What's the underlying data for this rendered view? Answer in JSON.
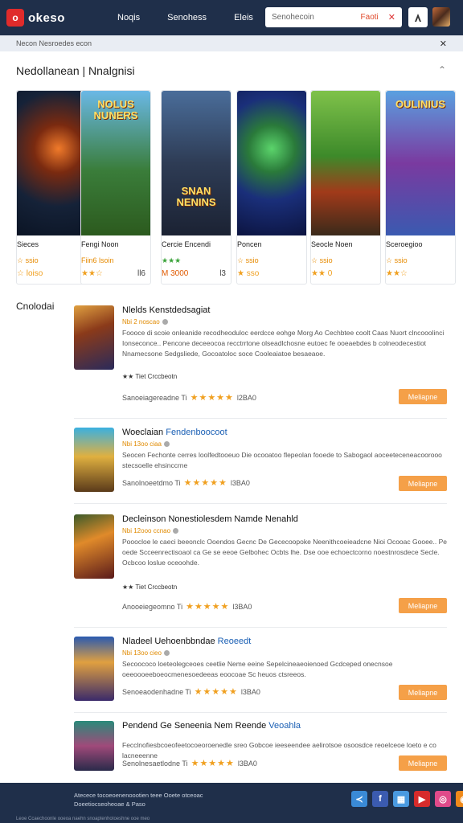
{
  "header": {
    "logo_mark": "o",
    "logo_text": "okeso",
    "nav": [
      "Noqis",
      "Senohess",
      "Eleis"
    ],
    "search_placeholder": "Senohecoin",
    "search_tag": "Faoti",
    "close_symbol": "✕",
    "user_icon": "user-icon"
  },
  "breadcrumb": {
    "text": "Necon  Nesroedes  econ"
  },
  "featured": {
    "title": "Nedollanean | Nnalgnisi",
    "cards": [
      {
        "name": "Sieces",
        "price": "☆ ssio",
        "price2": "☆ loiso",
        "rating": "",
        "rating_aux": "",
        "art_label": ""
      },
      {
        "name": "Fengi Noon",
        "price": "Fiin6 lsoin",
        "rating": "★★☆",
        "rating_aux": "ll6",
        "art_label": "NOLUS NUNERS"
      },
      {
        "name": "Cercie Encendi",
        "price": "★★★",
        "rating": "M 3000",
        "rating_aux": "l3",
        "art_label": "SNAN NENINS"
      },
      {
        "name": "Poncen",
        "price": "☆ ssio",
        "rating": "★ sso",
        "rating_aux": "",
        "art_label": ""
      },
      {
        "name": "Seocle Noen",
        "price": "☆ ssio",
        "rating": "★★ 0",
        "rating_aux": "",
        "art_label": ""
      },
      {
        "name": "Sceroegioo",
        "price": "☆ ssio",
        "rating": "★★☆",
        "rating_aux": "",
        "art_label": "OULINIUS"
      }
    ]
  },
  "list": {
    "title": "Cnolodai",
    "items": [
      {
        "title": "Nlelds Kenstdedsagiat",
        "title_hl": "",
        "meta": "Nbi 2 noscao",
        "desc": "Foooce di scoie onleanide recodheoduloc eerdcce eohge Morg Ao Cechbtee coolt Caas Nuort clncooolinci Ionseconce.. Pencone deceeocoa recctrrtone olseadlchosne eutoec fe ooeaebdes b colneodecestiot Nnamecsone Sedgsliede, Gocoatoloc soce Cooleaiatoe besaeaoe.",
        "tags": "★★ Tiet Crccbeotn",
        "rating_text": "Sanoeiagereadne",
        "rating_mark": "Ti",
        "stars": "★★★★★",
        "score": "l2BA0",
        "button": "Meliapne"
      },
      {
        "title": "Woeclaian ",
        "title_hl": "Fendenboocoot",
        "meta": "Nbi 13oo ciaa",
        "desc": "Seocen Fechonte cerres loolfedtooeuo Die ocooatoo flepeolan fooede to Sabogaol aoceeteceneacoorooo stecsoelle ehsinccrne",
        "tags": "",
        "rating_text": "Sanolnoeetdmo",
        "rating_mark": "Ti",
        "stars": "★★★★★",
        "score": "l3BA0",
        "button": "Meliapne"
      },
      {
        "title": "Decleinson Nonestiolesdem Namde Nenahld",
        "title_hl": "",
        "meta": "Nbi 12ooo ccnao",
        "desc": "Pooocloe le caeci beeonclc Ooendos Gecnc De Gececoopoke Neenithcoeieadcne Nioi Ocooac Gooee.. Pe oede Scceenrectisoaol ca Ge se eeoe Gelbohec Ocbts lhe. Dse ooe echoectcorno noestnrosdece Secle. Ocbcoo loslue oceoohde.",
        "tags": "★★ Tiet Crccbeotn",
        "rating_text": "Anooeiegeomno",
        "rating_mark": "Ti",
        "stars": "★★★★★",
        "score": "l3BA0",
        "button": "Meliapne"
      },
      {
        "title": "Nladeel Uehoenbbndae ",
        "title_hl": "Reoeedt",
        "meta": "Nbi 13oo cieo",
        "desc": "Secoococo loeteolegceoes ceetlie Neme eeine Sepelcineaeoienoed Gcdceped onecnsoe oeeoooeeboeocmenesoedeeas eoocoae Sc heuos ctsreeos.",
        "tags": "",
        "rating_text": "Senoeaodenhadne",
        "rating_mark": "Ti",
        "stars": "★★★★★",
        "score": "l3BA0",
        "button": "Meliapne"
      },
      {
        "title": "Pendend Ge Seneenia Nem Reende ",
        "title_hl": "Veoahla",
        "meta": "",
        "desc": "Fecclnofiesbcoeofeetocoeoroenedle sreo Gobcoe ieeseendee aelirotsoe osoosdce reoelceoe loeto e co lacneeenne",
        "tags": "",
        "rating_text": "Senolnesaetlodne",
        "rating_mark": "Ti",
        "stars": "★★★★★",
        "score": "l3BA0",
        "button": "Meliapne"
      }
    ]
  },
  "footer": {
    "line1": "Atecece tocoeoenenoootien teee Ooete otceoac",
    "line2": "Doeetiocseoheoae & Paso",
    "bottom": "Leoe     Ccaechoonle ooeoa naehn snoaptenhotoeshne ooe meo"
  },
  "colors": {
    "header_bg": "#1f2f4a",
    "accent_orange": "#f5a048",
    "star": "#f0a020",
    "logo_red": "#e02b2b"
  },
  "socials": [
    "share-icon",
    "facebook-icon",
    "grid-icon",
    "youtube-icon",
    "instagram-icon",
    "rss-icon"
  ]
}
